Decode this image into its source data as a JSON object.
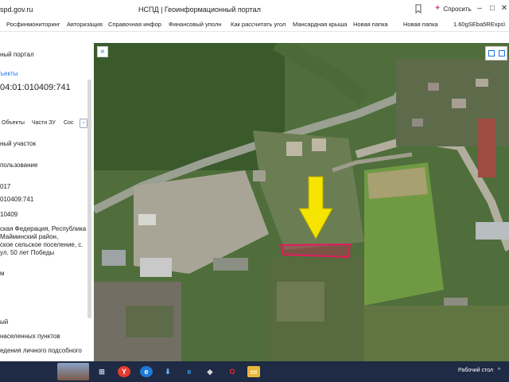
{
  "browser": {
    "url": "spd.gov.ru",
    "title": "НСПД | Геоинформационный портал",
    "ask_label": "Спросить",
    "bookmarks": [
      "Росфинмониторинг",
      "Авторизация",
      "Справочная инфор",
      "Финансовый уполн",
      "Как рассчитать угол",
      "Мансардная крыша",
      "Новая папка",
      "Новая папка",
      "1.60gSEba5RExps\\"
    ]
  },
  "left_panel": {
    "portal_title": "ный портал",
    "objects_link": "ъекты",
    "cadastral_number": "04:01:010409:741",
    "tabs": [
      "Объекты",
      "Части ЗУ",
      "Сос"
    ],
    "tab_next": "›",
    "lines": [
      "ный участок",
      "пользование",
      "017",
      "010409:741",
      "10409",
      "ская Федерация, Республика",
      "Майминский район,",
      "ское сельское поселение, с.",
      "ул. 50 лет Победы",
      "м",
      "ый",
      "населенных пунктов",
      "едения личного подсобного"
    ]
  },
  "map": {
    "collapse_label": "«",
    "parcel_color": "#e5195e",
    "arrow_color": "#f5e400"
  },
  "taskbar": {
    "desktop_label": "Рабочий стол",
    "up_label": "^"
  }
}
